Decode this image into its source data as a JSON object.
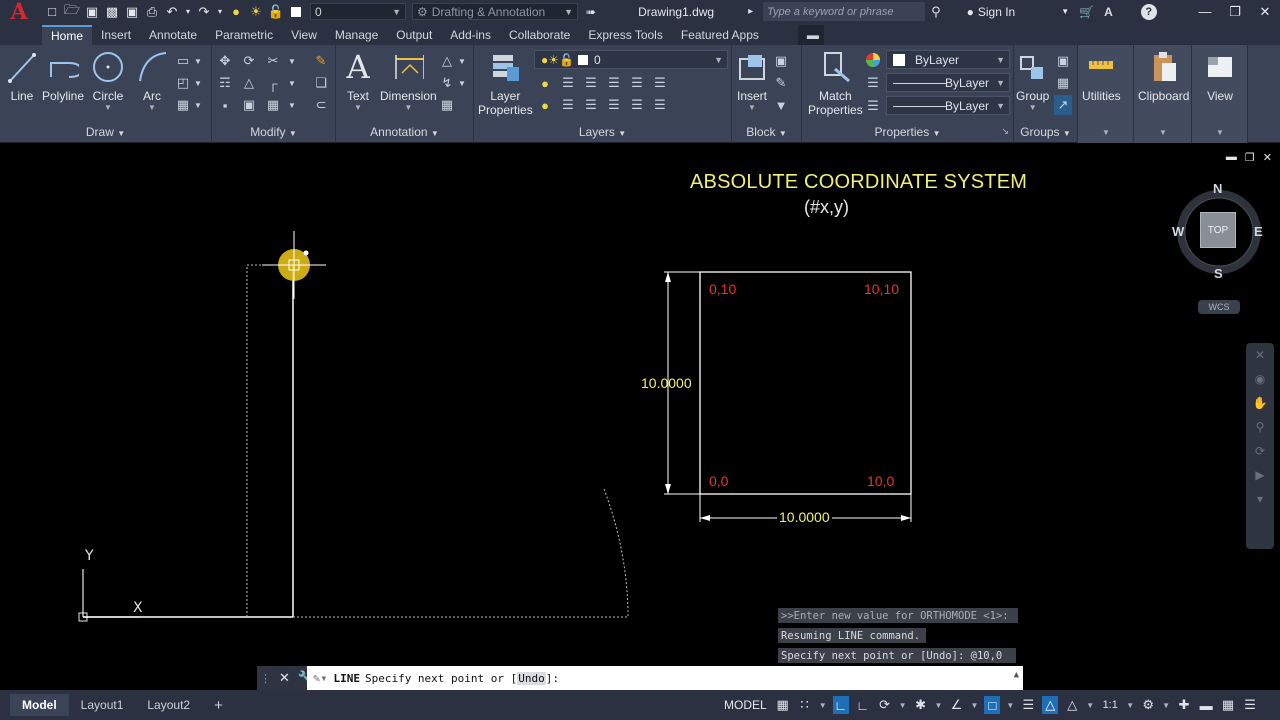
{
  "app": {
    "logo": "A",
    "document_title": "Drawing1.dwg"
  },
  "titlebar": {
    "layer_value": "0",
    "workspace": "Drafting & Annotation",
    "search_placeholder": "Type a keyword or phrase",
    "sign_in": "Sign In"
  },
  "tabs": [
    {
      "label": "Home",
      "active": true
    },
    {
      "label": "Insert"
    },
    {
      "label": "Annotate"
    },
    {
      "label": "Parametric"
    },
    {
      "label": "View"
    },
    {
      "label": "Manage"
    },
    {
      "label": "Output"
    },
    {
      "label": "Add-ins"
    },
    {
      "label": "Collaborate"
    },
    {
      "label": "Express Tools"
    },
    {
      "label": "Featured Apps"
    }
  ],
  "ribbon": {
    "draw": {
      "panel": "Draw",
      "line": "Line",
      "polyline": "Polyline",
      "circle": "Circle",
      "arc": "Arc"
    },
    "modify": {
      "panel": "Modify"
    },
    "annotation": {
      "panel": "Annotation",
      "text": "Text",
      "dimension": "Dimension"
    },
    "layers": {
      "panel": "Layers",
      "layer_properties_1": "Layer",
      "layer_properties_2": "Properties",
      "current_layer": "0"
    },
    "block": {
      "panel": "Block",
      "insert": "Insert"
    },
    "properties": {
      "panel": "Properties",
      "match_1": "Match",
      "match_2": "Properties",
      "color": "ByLayer",
      "linetype": "ByLayer",
      "lineweight": "ByLayer"
    },
    "groups": {
      "panel": "Groups",
      "group": "Group"
    },
    "utilities": "Utilities",
    "clipboard": "Clipboard",
    "view": "View"
  },
  "canvas": {
    "title": "ABSOLUTE COORDINATE SYSTEM",
    "subtitle": "(#x,y)",
    "coords": {
      "top_left": "0,10",
      "top_right": "10,10",
      "bottom_left": "0,0",
      "bottom_right": "10,0"
    },
    "dim_vertical": "10.0000",
    "dim_horizontal": "10.0000",
    "ucs_x": "X",
    "ucs_y": "Y"
  },
  "viewcube": {
    "north": "N",
    "south": "S",
    "east": "E",
    "west": "W",
    "top": "TOP",
    "wcs": "WCS"
  },
  "command": {
    "history": [
      ">>Enter new value for ORTHOMODE <1>:",
      "Resuming LINE command.",
      "Specify next point or [Undo]: @10,0"
    ],
    "name": "LINE",
    "prompt_before": "Specify next point or [",
    "option": "Undo",
    "prompt_after": "]:"
  },
  "layouts": [
    {
      "label": "Model",
      "active": true
    },
    {
      "label": "Layout1"
    },
    {
      "label": "Layout2"
    }
  ],
  "status": {
    "model": "MODEL",
    "scale": "1:1"
  },
  "colors": {
    "accent": "#5b9bd5",
    "title_yellow": "#f0ef7a",
    "coord_red": "#e5362b",
    "ribbon": "#3b4456"
  }
}
